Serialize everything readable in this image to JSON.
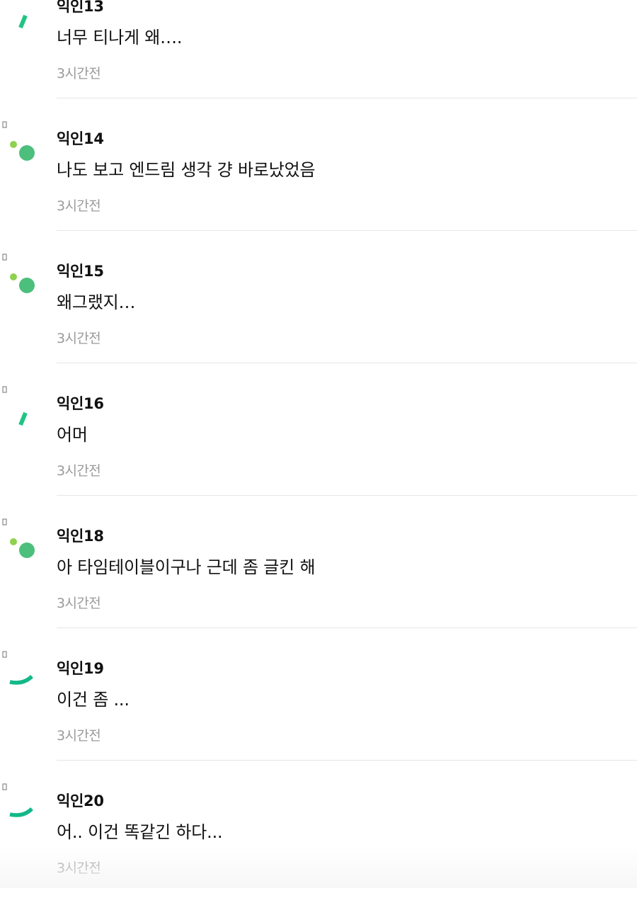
{
  "comments": [
    {
      "author": "익인13",
      "text": "너무 티나게 왜….",
      "time": "3시간전",
      "avatar_icon": "loading-slash-icon",
      "avatar_color": "#1fc483"
    },
    {
      "author": "익인14",
      "text": "나도 보고 엔드림 생각 걍 바로났었음",
      "time": "3시간전",
      "avatar_icon": "loading-dots-icon",
      "avatar_color": "#4cbf7c"
    },
    {
      "author": "익인15",
      "text": "왜그랬지…",
      "time": "3시간전",
      "avatar_icon": "loading-dots-icon",
      "avatar_color": "#4cbf7c"
    },
    {
      "author": "익인16",
      "text": "어머",
      "time": "3시간전",
      "avatar_icon": "loading-slash-icon",
      "avatar_color": "#1fc483"
    },
    {
      "author": "익인18",
      "text": "아 타임테이블이구나 근데 좀 글킨 해",
      "time": "3시간전",
      "avatar_icon": "loading-dots-icon",
      "avatar_color": "#4cbf7c"
    },
    {
      "author": "익인19",
      "text": "이건 좀 ...",
      "time": "3시간전",
      "avatar_icon": "loading-arc-icon",
      "avatar_color": "#12b889"
    },
    {
      "author": "익인20",
      "text": "어.. 이건 똑같긴 하다...",
      "time": "3시간전",
      "avatar_icon": "loading-arc-icon",
      "avatar_color": "#12b889"
    }
  ],
  "colors": {
    "author_text": "#111111",
    "body_text": "#111111",
    "time_text": "#9a9a9a",
    "divider": "#e6e6e6",
    "accent_light_green": "#8fd14f"
  }
}
